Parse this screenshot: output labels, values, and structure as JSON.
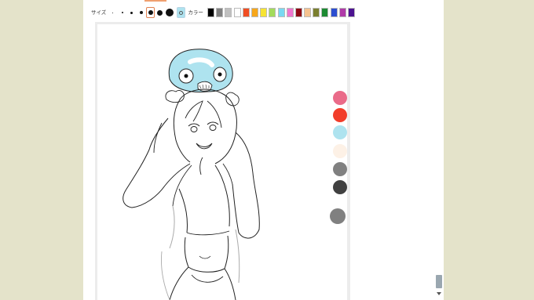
{
  "toolbar": {
    "size_label": "サイズ",
    "color_label": "カラー",
    "sizes": [
      1,
      2,
      3,
      4,
      6,
      7,
      10
    ],
    "selected_size_index": 4,
    "colors": [
      "#000000",
      "#808080",
      "#c0c0c0",
      "#ffffff",
      "#f04e23",
      "#f7a71b",
      "#f7e433",
      "#a3db5c",
      "#7ad9f2",
      "#ef77cf",
      "#8f0a14",
      "#f5c390",
      "#7b7f2f",
      "#1d8a33",
      "#2c4ed0",
      "#b03aa8",
      "#4c1390"
    ],
    "current_color": "#aee3ef"
  },
  "canvas_palette": [
    "#ea6b89",
    "#f23d2a",
    "#aee3ef",
    "#fdf1e6",
    "#808080",
    "#404040",
    "#808080"
  ]
}
